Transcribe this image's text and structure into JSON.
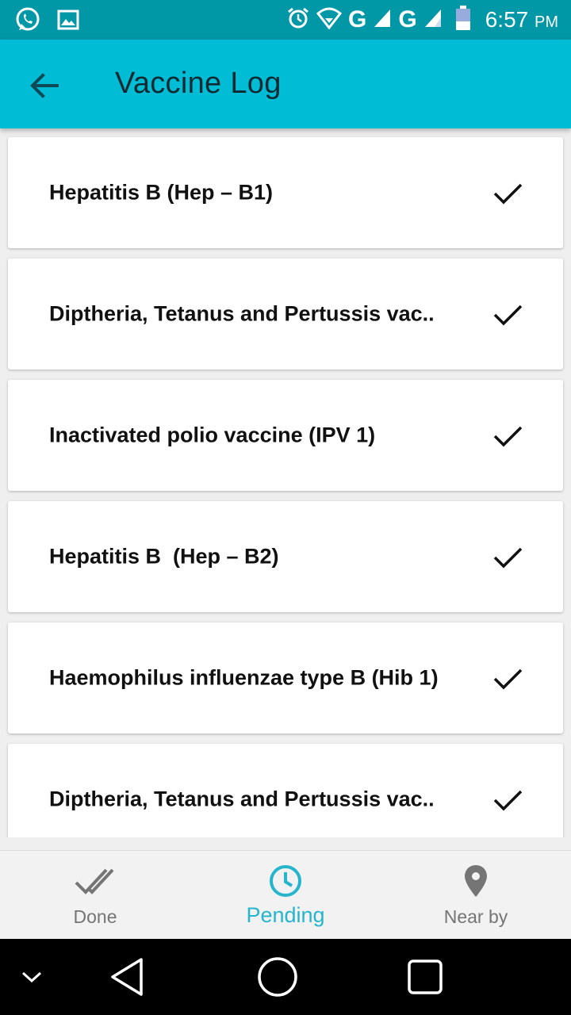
{
  "status_bar": {
    "time": "6:57",
    "ampm": "PM",
    "network_1": "G",
    "network_2": "G",
    "icons": [
      "whatsapp-icon",
      "image-icon",
      "alarm-icon",
      "wifi-icon",
      "signal-icon",
      "signal-icon",
      "battery-icon"
    ]
  },
  "app_bar": {
    "title": "Vaccine Log",
    "back_icon": "arrow-back-icon"
  },
  "vaccines": [
    {
      "name": "Hepatitis B (Hep – B1)",
      "status_icon": "check-icon"
    },
    {
      "name": "Diptheria, Tetanus and Pertussis vac..",
      "status_icon": "check-icon"
    },
    {
      "name": "Inactivated polio vaccine (IPV 1)",
      "status_icon": "check-icon"
    },
    {
      "name": "Hepatitis B  (Hep – B2)",
      "status_icon": "check-icon"
    },
    {
      "name": "Haemophilus influenzae type B (Hib 1)",
      "status_icon": "check-icon"
    },
    {
      "name": "Diptheria, Tetanus and Pertussis vac..",
      "status_icon": "check-icon"
    }
  ],
  "bottom_nav": {
    "items": [
      {
        "label": "Done",
        "icon": "double-check-icon",
        "active": false
      },
      {
        "label": "Pending",
        "icon": "clock-icon",
        "active": true
      },
      {
        "label": "Near by",
        "icon": "location-pin-icon",
        "active": false
      }
    ]
  },
  "colors": {
    "status_bar": "#0097a7",
    "app_bar": "#00bcd4",
    "active_tab": "#26b5cc",
    "inactive_tab": "#757575"
  }
}
